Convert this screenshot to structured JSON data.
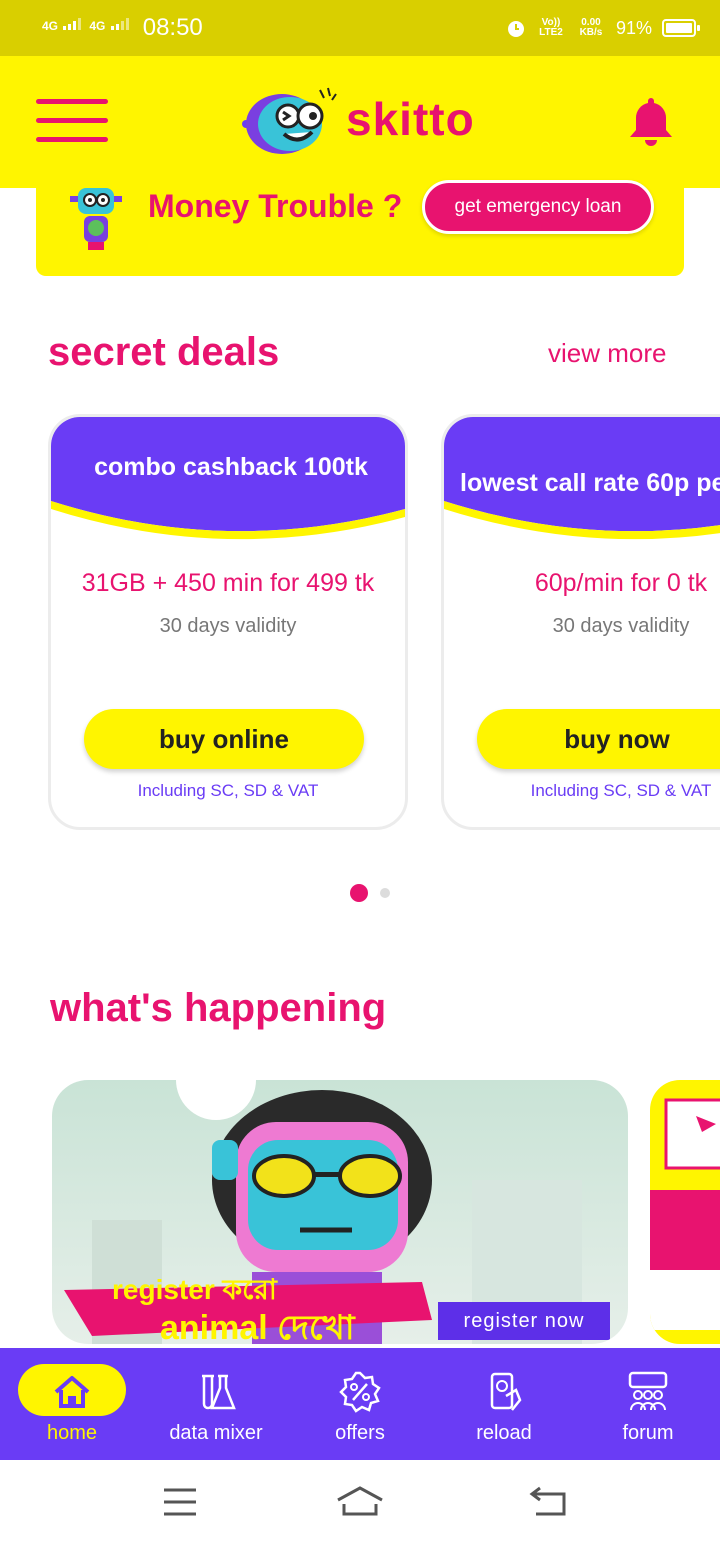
{
  "status_bar": {
    "network1": "4G",
    "network2": "4G",
    "time": "08:50",
    "volte": "Vo)) LTE2",
    "speed": "0.00 KB/s",
    "battery": "91%"
  },
  "header": {
    "app_name": "skitto"
  },
  "banner": {
    "title": "Money Trouble ?",
    "button": "get emergency loan"
  },
  "secret_deals": {
    "title": "secret deals",
    "view_more": "view more",
    "cards": [
      {
        "header": "combo cashback 100tk",
        "offer": "31GB + 450 min for  499 tk",
        "validity": "30 days validity",
        "button": "buy online",
        "note": "Including SC, SD & VAT"
      },
      {
        "header": "lowest call rate 60p pe",
        "offer": "60p/min for  0 tk",
        "validity": "30 days validity",
        "button": "buy now",
        "note": "Including SC, SD & VAT"
      }
    ]
  },
  "whats_happening": {
    "title": "what's happening",
    "promo_line1": "register করো",
    "promo_line2": "animal দেখো",
    "promo_button": "register now"
  },
  "bottom_nav": [
    {
      "label": "home",
      "icon": "home-icon",
      "active": true
    },
    {
      "label": "data mixer",
      "icon": "flask-icon",
      "active": false
    },
    {
      "label": "offers",
      "icon": "percent-badge-icon",
      "active": false
    },
    {
      "label": "reload",
      "icon": "phone-reload-icon",
      "active": false
    },
    {
      "label": "forum",
      "icon": "people-chat-icon",
      "active": false
    }
  ],
  "colors": {
    "brand_yellow": "#fff500",
    "brand_pink": "#e8136f",
    "brand_purple": "#6a3cf5"
  }
}
